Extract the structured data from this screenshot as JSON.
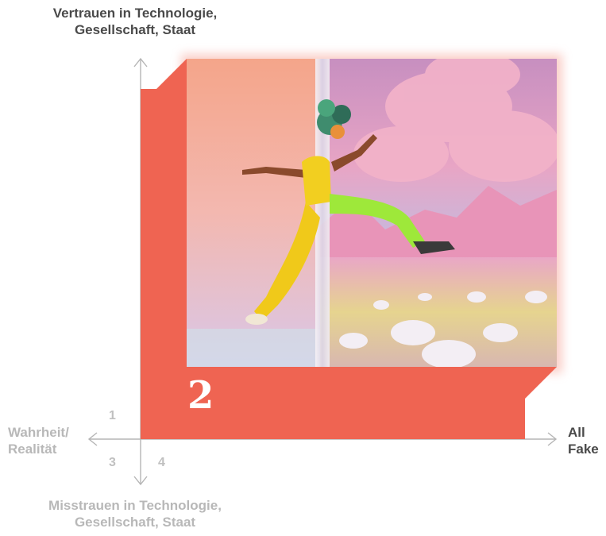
{
  "axes": {
    "top": "Vertrauen in Technologie,\nGesellschaft, Staat",
    "bottom": "Misstrauen in Technologie,\nGesellschaft, Staat",
    "left": "Wahrheit/\nRealität",
    "right": "All\nFake"
  },
  "quadrant_numbers": {
    "q1": "1",
    "q3": "3",
    "q4": "4"
  },
  "highlighted_quadrant": "2",
  "colors": {
    "highlight": "#ef6452",
    "axis": "#b5b5b5",
    "dark_text": "#4a4a4a",
    "light_text": "#b8b8b8"
  },
  "image": {
    "description_icon": "split-world-jumping-person-image"
  }
}
